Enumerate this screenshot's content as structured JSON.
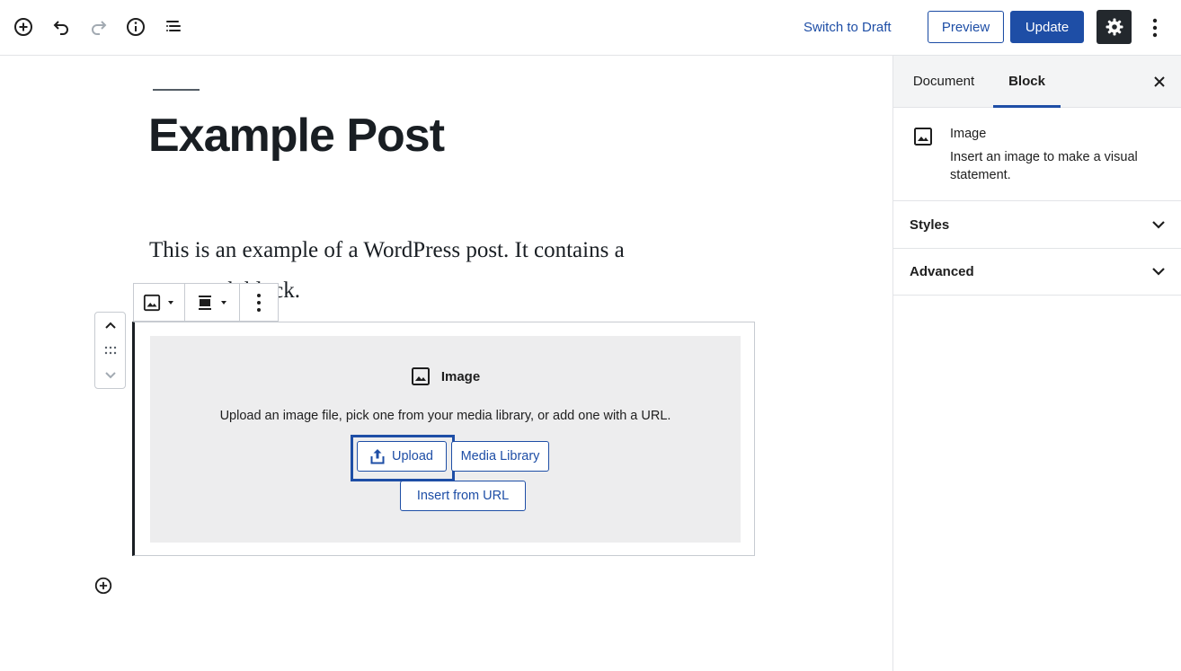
{
  "toolbar": {
    "switch_to_draft": "Switch to Draft",
    "preview": "Preview",
    "update": "Update",
    "icons": [
      "add-block-icon",
      "undo-icon",
      "redo-icon",
      "info-icon",
      "block-navigation-icon",
      "gear-icon",
      "more-options-icon"
    ]
  },
  "post": {
    "title": "Example Post",
    "paragraph": "This is an example of a WordPress post. It contains a paragraph block."
  },
  "image_block": {
    "label": "Image",
    "instructions": "Upload an image file, pick one from your media library, or add one with a URL.",
    "upload": "Upload",
    "media_library": "Media Library",
    "insert_from_url": "Insert from URL"
  },
  "sidebar": {
    "tabs": [
      {
        "label": "Document",
        "active": false
      },
      {
        "label": "Block",
        "active": true
      }
    ],
    "block_card": {
      "title": "Image",
      "description": "Insert an image to make a visual statement."
    },
    "panels": [
      {
        "label": "Styles"
      },
      {
        "label": "Advanced"
      }
    ]
  },
  "colors": {
    "accent": "#1e4ea6",
    "settings_bg": "#23282d",
    "placeholder_bg": "#ededee"
  }
}
